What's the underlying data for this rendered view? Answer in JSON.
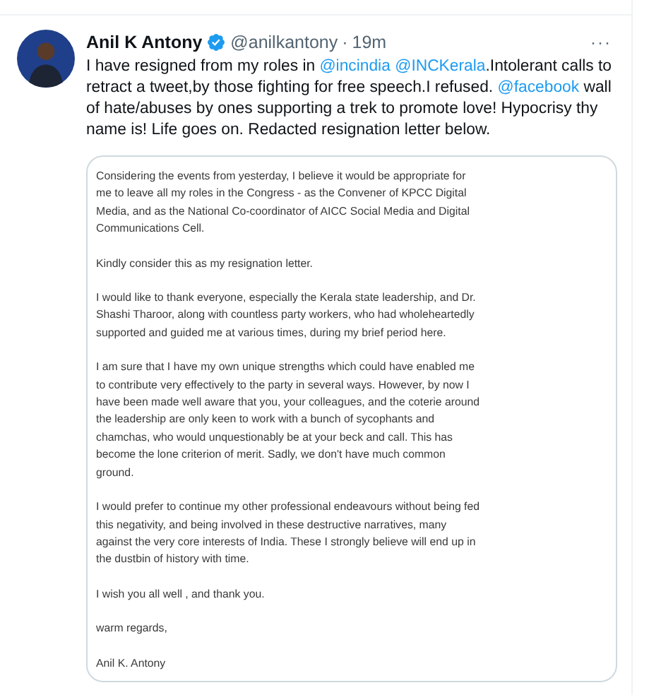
{
  "tweet": {
    "author": {
      "name": "Anil K Antony",
      "verified": true,
      "handle": "@anilkantony",
      "separator": "·",
      "time": "19m"
    },
    "more": "···",
    "text": [
      {
        "kind": "text",
        "text": "I have resigned from my roles in "
      },
      {
        "kind": "mention",
        "text": "@incindia",
        "space_after": true
      },
      {
        "kind": "mention",
        "text": "@INCKerala"
      },
      {
        "kind": "text",
        "text": ".Intolerant calls to retract a tweet,by those fighting for free speech.I refused. "
      },
      {
        "kind": "mention",
        "text": "@facebook"
      },
      {
        "kind": "text",
        "text": " wall of hate/abuses by ones supporting a trek to promote love! Hypocrisy thy name is! Life goes on. Redacted resignation letter below."
      }
    ],
    "letter": {
      "paragraphs": [
        "Considering the events from yesterday, I believe it would be appropriate for me to leave all my roles in the Congress - as the Convener of KPCC Digital Media, and as the National Co-coordinator of AICC Social Media and Digital Communications Cell.",
        "Kindly consider this as my resignation letter.",
        "I would like to thank everyone, especially the Kerala state leadership, and Dr. Shashi Tharoor, along with countless party workers, who had wholeheartedly supported and guided me at various times, during my brief period here.",
        "I am sure that I have my own unique strengths which could have enabled me to contribute very effectively to the party in several ways. However, by now I have been made well aware that you, your colleagues, and the coterie around the leadership are only keen to work with a bunch of sycophants and chamchas, who would unquestionably be at your beck and call. This has become the lone criterion of merit. Sadly, we don't have much common ground.",
        "I would prefer to continue my other professional endeavours without being fed this negativity, and being involved in these destructive narratives, many against the very core interests of India. These I strongly believe will end up in the dustbin of history with time.",
        "I wish you all well , and thank you.",
        "warm regards,",
        "Anil K. Antony"
      ]
    }
  }
}
